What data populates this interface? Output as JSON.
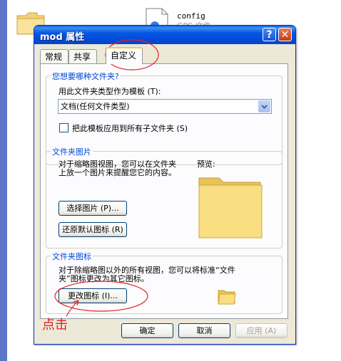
{
  "background": {
    "file_label": "config",
    "file_sublabel": "GPS 文件"
  },
  "dialog": {
    "title": "mod 属性",
    "help_glyph": "?",
    "close_glyph": "✕",
    "tabs": [
      {
        "label": "常规"
      },
      {
        "label": "共享"
      },
      {
        "label": "自定义"
      }
    ],
    "folder_type": {
      "legend": "您想要哪种文件夹?",
      "template_label": "用此文件夹类型作为模板 (T):",
      "template_value": "文档(任何文件类型)",
      "apply_subfolders_label": "把此模板应用到所有子文件夹 (S)",
      "apply_subfolders_checked": false
    },
    "folder_pictures": {
      "legend": "文件夹图片",
      "description_line1": "对于缩略图视图，您可以在文件夹",
      "description_line2": "上放一个图片来提醒您它的内容。",
      "preview_label": "预览:",
      "choose_picture_label": "选择图片 (P)...",
      "restore_default_label": "还原默认图标 (R)"
    },
    "folder_icons": {
      "legend": "文件夹图标",
      "description_line1": "对于除缩略图以外的所有视图，您可以将标准“文件",
      "description_line2": "夹”图标更改为其它图标。",
      "change_icon_label": "更改图标 (I)..."
    },
    "buttons": {
      "ok": "确定",
      "cancel": "取消",
      "apply": "应用 (A)"
    }
  },
  "annotation": {
    "text": "点击",
    "color": "#e42020"
  },
  "colors": {
    "titlebar": "#0556e3",
    "dialog_bg": "#ece9d8",
    "legend_text": "#0046d5",
    "left_strip": "#5a76c6"
  }
}
